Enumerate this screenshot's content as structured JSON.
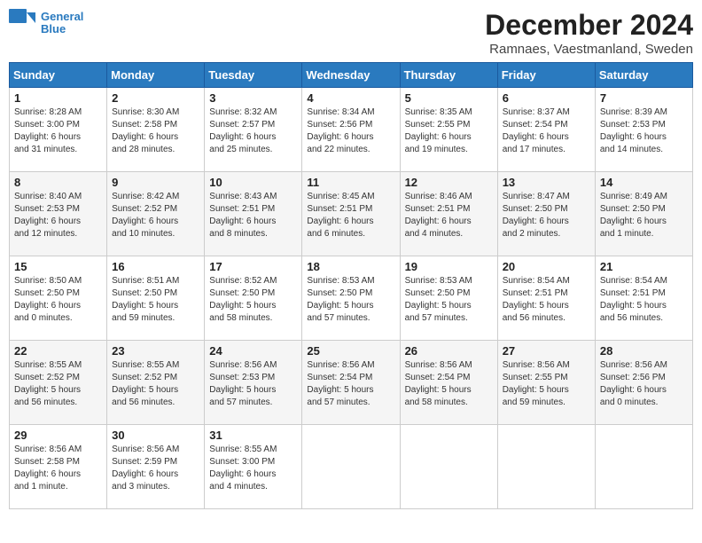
{
  "logo": {
    "line1": "General",
    "line2": "Blue"
  },
  "title": "December 2024",
  "subtitle": "Ramnaes, Vaestmanland, Sweden",
  "weekdays": [
    "Sunday",
    "Monday",
    "Tuesday",
    "Wednesday",
    "Thursday",
    "Friday",
    "Saturday"
  ],
  "weeks": [
    [
      {
        "day": "1",
        "info": "Sunrise: 8:28 AM\nSunset: 3:00 PM\nDaylight: 6 hours\nand 31 minutes."
      },
      {
        "day": "2",
        "info": "Sunrise: 8:30 AM\nSunset: 2:58 PM\nDaylight: 6 hours\nand 28 minutes."
      },
      {
        "day": "3",
        "info": "Sunrise: 8:32 AM\nSunset: 2:57 PM\nDaylight: 6 hours\nand 25 minutes."
      },
      {
        "day": "4",
        "info": "Sunrise: 8:34 AM\nSunset: 2:56 PM\nDaylight: 6 hours\nand 22 minutes."
      },
      {
        "day": "5",
        "info": "Sunrise: 8:35 AM\nSunset: 2:55 PM\nDaylight: 6 hours\nand 19 minutes."
      },
      {
        "day": "6",
        "info": "Sunrise: 8:37 AM\nSunset: 2:54 PM\nDaylight: 6 hours\nand 17 minutes."
      },
      {
        "day": "7",
        "info": "Sunrise: 8:39 AM\nSunset: 2:53 PM\nDaylight: 6 hours\nand 14 minutes."
      }
    ],
    [
      {
        "day": "8",
        "info": "Sunrise: 8:40 AM\nSunset: 2:53 PM\nDaylight: 6 hours\nand 12 minutes."
      },
      {
        "day": "9",
        "info": "Sunrise: 8:42 AM\nSunset: 2:52 PM\nDaylight: 6 hours\nand 10 minutes."
      },
      {
        "day": "10",
        "info": "Sunrise: 8:43 AM\nSunset: 2:51 PM\nDaylight: 6 hours\nand 8 minutes."
      },
      {
        "day": "11",
        "info": "Sunrise: 8:45 AM\nSunset: 2:51 PM\nDaylight: 6 hours\nand 6 minutes."
      },
      {
        "day": "12",
        "info": "Sunrise: 8:46 AM\nSunset: 2:51 PM\nDaylight: 6 hours\nand 4 minutes."
      },
      {
        "day": "13",
        "info": "Sunrise: 8:47 AM\nSunset: 2:50 PM\nDaylight: 6 hours\nand 2 minutes."
      },
      {
        "day": "14",
        "info": "Sunrise: 8:49 AM\nSunset: 2:50 PM\nDaylight: 6 hours\nand 1 minute."
      }
    ],
    [
      {
        "day": "15",
        "info": "Sunrise: 8:50 AM\nSunset: 2:50 PM\nDaylight: 6 hours\nand 0 minutes."
      },
      {
        "day": "16",
        "info": "Sunrise: 8:51 AM\nSunset: 2:50 PM\nDaylight: 5 hours\nand 59 minutes."
      },
      {
        "day": "17",
        "info": "Sunrise: 8:52 AM\nSunset: 2:50 PM\nDaylight: 5 hours\nand 58 minutes."
      },
      {
        "day": "18",
        "info": "Sunrise: 8:53 AM\nSunset: 2:50 PM\nDaylight: 5 hours\nand 57 minutes."
      },
      {
        "day": "19",
        "info": "Sunrise: 8:53 AM\nSunset: 2:50 PM\nDaylight: 5 hours\nand 57 minutes."
      },
      {
        "day": "20",
        "info": "Sunrise: 8:54 AM\nSunset: 2:51 PM\nDaylight: 5 hours\nand 56 minutes."
      },
      {
        "day": "21",
        "info": "Sunrise: 8:54 AM\nSunset: 2:51 PM\nDaylight: 5 hours\nand 56 minutes."
      }
    ],
    [
      {
        "day": "22",
        "info": "Sunrise: 8:55 AM\nSunset: 2:52 PM\nDaylight: 5 hours\nand 56 minutes."
      },
      {
        "day": "23",
        "info": "Sunrise: 8:55 AM\nSunset: 2:52 PM\nDaylight: 5 hours\nand 56 minutes."
      },
      {
        "day": "24",
        "info": "Sunrise: 8:56 AM\nSunset: 2:53 PM\nDaylight: 5 hours\nand 57 minutes."
      },
      {
        "day": "25",
        "info": "Sunrise: 8:56 AM\nSunset: 2:54 PM\nDaylight: 5 hours\nand 57 minutes."
      },
      {
        "day": "26",
        "info": "Sunrise: 8:56 AM\nSunset: 2:54 PM\nDaylight: 5 hours\nand 58 minutes."
      },
      {
        "day": "27",
        "info": "Sunrise: 8:56 AM\nSunset: 2:55 PM\nDaylight: 5 hours\nand 59 minutes."
      },
      {
        "day": "28",
        "info": "Sunrise: 8:56 AM\nSunset: 2:56 PM\nDaylight: 6 hours\nand 0 minutes."
      }
    ],
    [
      {
        "day": "29",
        "info": "Sunrise: 8:56 AM\nSunset: 2:58 PM\nDaylight: 6 hours\nand 1 minute."
      },
      {
        "day": "30",
        "info": "Sunrise: 8:56 AM\nSunset: 2:59 PM\nDaylight: 6 hours\nand 3 minutes."
      },
      {
        "day": "31",
        "info": "Sunrise: 8:55 AM\nSunset: 3:00 PM\nDaylight: 6 hours\nand 4 minutes."
      },
      {
        "day": "",
        "info": ""
      },
      {
        "day": "",
        "info": ""
      },
      {
        "day": "",
        "info": ""
      },
      {
        "day": "",
        "info": ""
      }
    ]
  ]
}
